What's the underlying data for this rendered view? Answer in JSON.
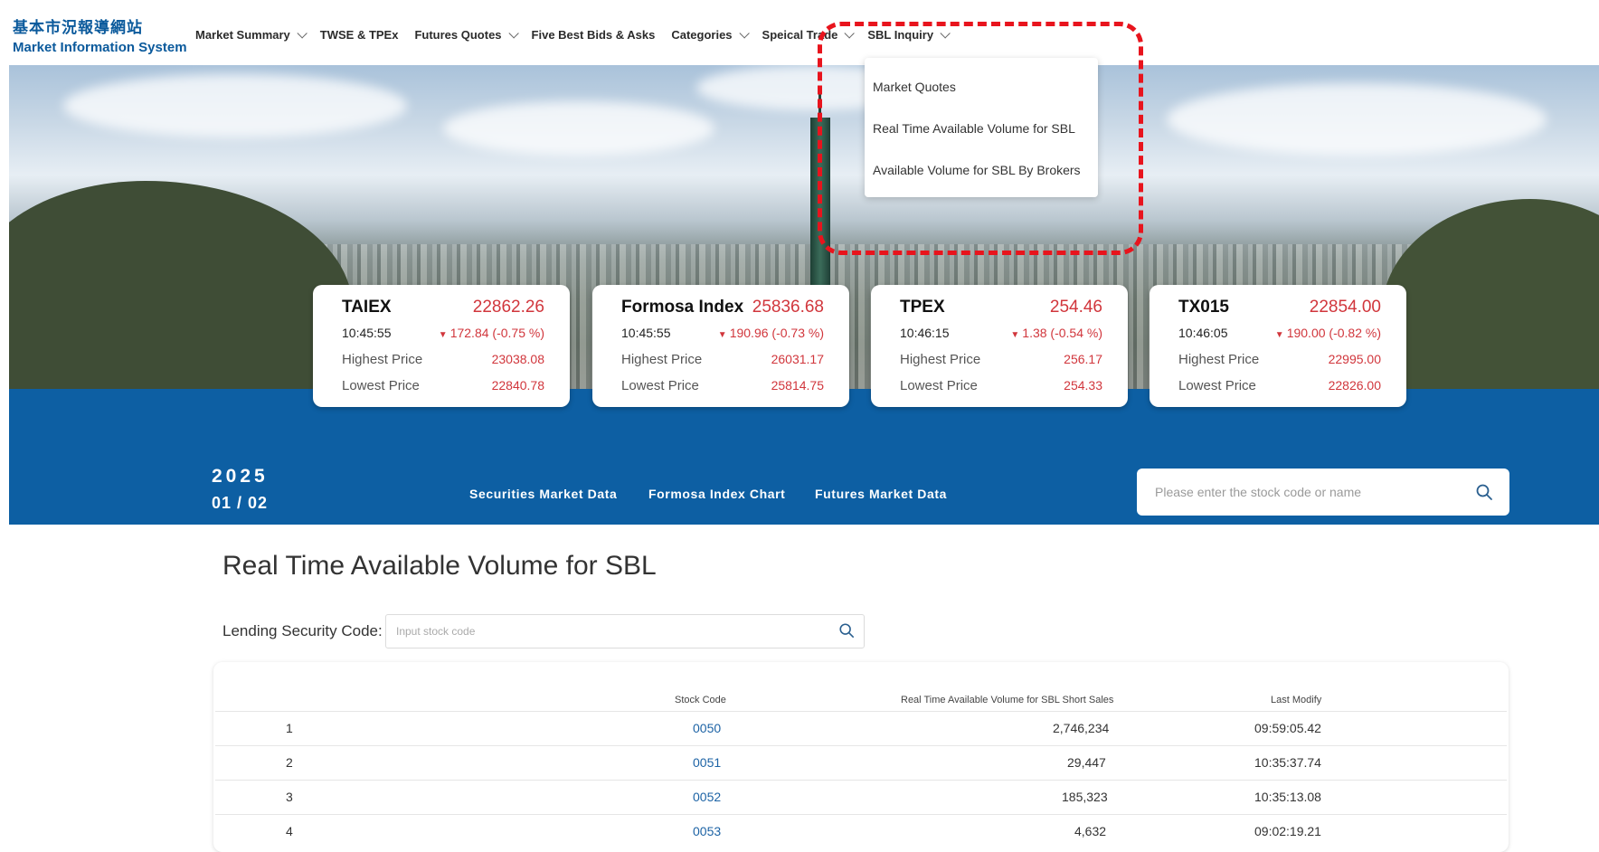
{
  "logo": {
    "zh": "基本市況報導網站",
    "en": "Market Information System"
  },
  "nav": [
    {
      "label": "Market Summary",
      "dropdown": true
    },
    {
      "label": "TWSE & TPEx",
      "dropdown": false
    },
    {
      "label": "Futures Quotes",
      "dropdown": true
    },
    {
      "label": "Five Best Bids & Asks",
      "dropdown": false
    },
    {
      "label": "Categories",
      "dropdown": true
    },
    {
      "label": "Speical Trade",
      "dropdown": true
    },
    {
      "label": "SBL Inquiry",
      "dropdown": true
    }
  ],
  "dropdown": {
    "items": [
      "Market Quotes",
      "Real Time Available Volume for SBL",
      "Available Volume for SBL By Brokers"
    ]
  },
  "cards": [
    {
      "name": "TAIEX",
      "value": "22862.26",
      "time": "10:45:55",
      "change": "172.84 (-0.75 %)",
      "high_label": "Highest Price",
      "high": "23038.08",
      "low_label": "Lowest Price",
      "low": "22840.78"
    },
    {
      "name": "Formosa Index",
      "value": "25836.68",
      "time": "10:45:55",
      "change": "190.96 (-0.73 %)",
      "high_label": "Highest Price",
      "high": "26031.17",
      "low_label": "Lowest Price",
      "low": "25814.75"
    },
    {
      "name": "TPEX",
      "value": "254.46",
      "time": "10:46:15",
      "change": "1.38 (-0.54 %)",
      "high_label": "Highest Price",
      "high": "256.17",
      "low_label": "Lowest Price",
      "low": "254.33"
    },
    {
      "name": "TX015",
      "value": "22854.00",
      "time": "10:46:05",
      "change": "190.00 (-0.82 %)",
      "high_label": "Highest Price",
      "high": "22995.00",
      "low_label": "Lowest Price",
      "low": "22826.00"
    }
  ],
  "down_glyph": "▼",
  "date": {
    "year": "2025",
    "month_day": "01 / 02"
  },
  "subtabs": [
    "Securities Market Data",
    "Formosa Index Chart",
    "Futures Market Data"
  ],
  "search": {
    "placeholder": "Please enter the stock code or name"
  },
  "page_title": "Real Time Available Volume for SBL",
  "lending": {
    "label": "Lending Security Code:",
    "placeholder": "Input stock code"
  },
  "table": {
    "headers": [
      "Stock Code",
      "Real Time Available Volume for SBL Short Sales",
      "Last Modify"
    ],
    "rows": [
      {
        "idx": "1",
        "code": "0050",
        "volume": "2,746,234",
        "modified": "09:59:05.42"
      },
      {
        "idx": "2",
        "code": "0051",
        "volume": "29,447",
        "modified": "10:35:37.74"
      },
      {
        "idx": "3",
        "code": "0052",
        "volume": "185,323",
        "modified": "10:35:13.08"
      },
      {
        "idx": "4",
        "code": "0053",
        "volume": "4,632",
        "modified": "09:02:19.21"
      }
    ]
  },
  "colors": {
    "brand_blue": "#0d5fa3",
    "down_red": "#d1363c",
    "highlight_red": "#e8141d",
    "link_blue": "#1d63a5"
  },
  "icons": {
    "search": "search-icon",
    "chevron": "chevron-down-icon"
  }
}
